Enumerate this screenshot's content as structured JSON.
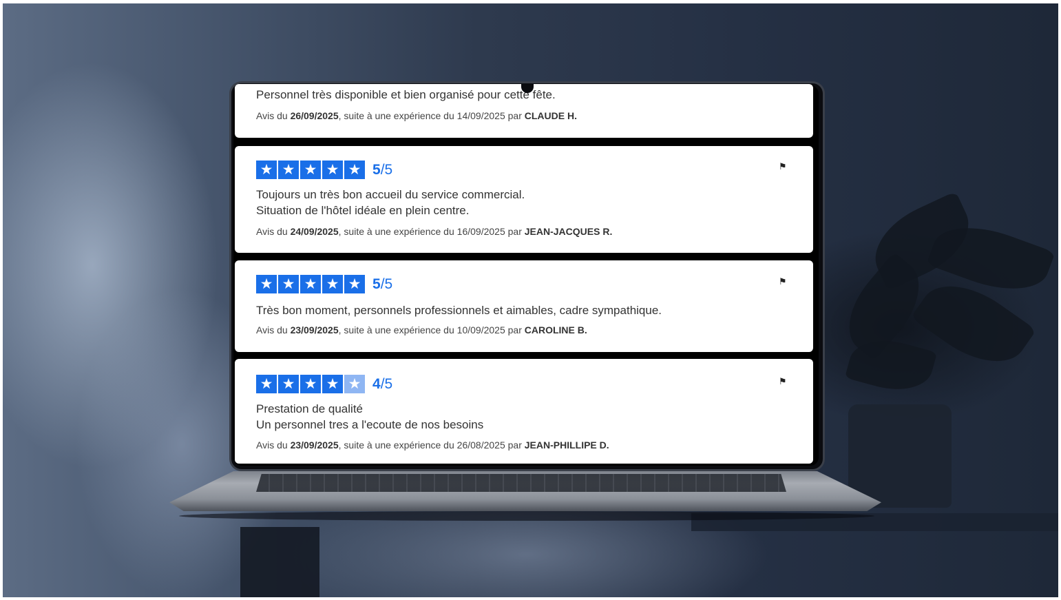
{
  "reviews": [
    {
      "text_lines": [
        "Personnel très disponible et bien organisé pour cette fête."
      ],
      "prefix": "Avis du",
      "review_date": "26/09/2025",
      "middle": ", suite à une expérience du",
      "experience_date": "14/09/2025",
      "by": "par",
      "author": "CLAUDE H."
    },
    {
      "rating": "5",
      "rating_max": "/5",
      "stars_filled": 5,
      "text_lines": [
        "Toujours un très bon accueil du service commercial.",
        "Situation de l'hôtel idéale en plein centre."
      ],
      "prefix": "Avis du",
      "review_date": "24/09/2025",
      "middle": ", suite à une expérience du",
      "experience_date": "16/09/2025",
      "by": "par",
      "author": "JEAN-JACQUES R."
    },
    {
      "rating": "5",
      "rating_max": "/5",
      "stars_filled": 5,
      "text_lines": [
        "Très bon moment, personnels professionnels et aimables, cadre sympathique."
      ],
      "prefix": "Avis du",
      "review_date": "23/09/2025",
      "middle": ", suite à une expérience du",
      "experience_date": "10/09/2025",
      "by": "par",
      "author": "CAROLINE B."
    },
    {
      "rating": "4",
      "rating_max": "/5",
      "stars_filled": 4,
      "text_lines": [
        "Prestation de qualité",
        "Un personnel tres a l'ecoute de nos besoins"
      ],
      "prefix": "Avis du",
      "review_date": "23/09/2025",
      "middle": ", suite à une expérience du",
      "experience_date": "26/08/2025",
      "by": "par",
      "author": "JEAN-PHILLIPE D."
    }
  ],
  "icons": {
    "star": "★",
    "flag": "⚑"
  },
  "colors": {
    "star_fill": "#1a6fe8",
    "star_dim": "#8fb6f3",
    "card_bg": "#ffffff"
  }
}
